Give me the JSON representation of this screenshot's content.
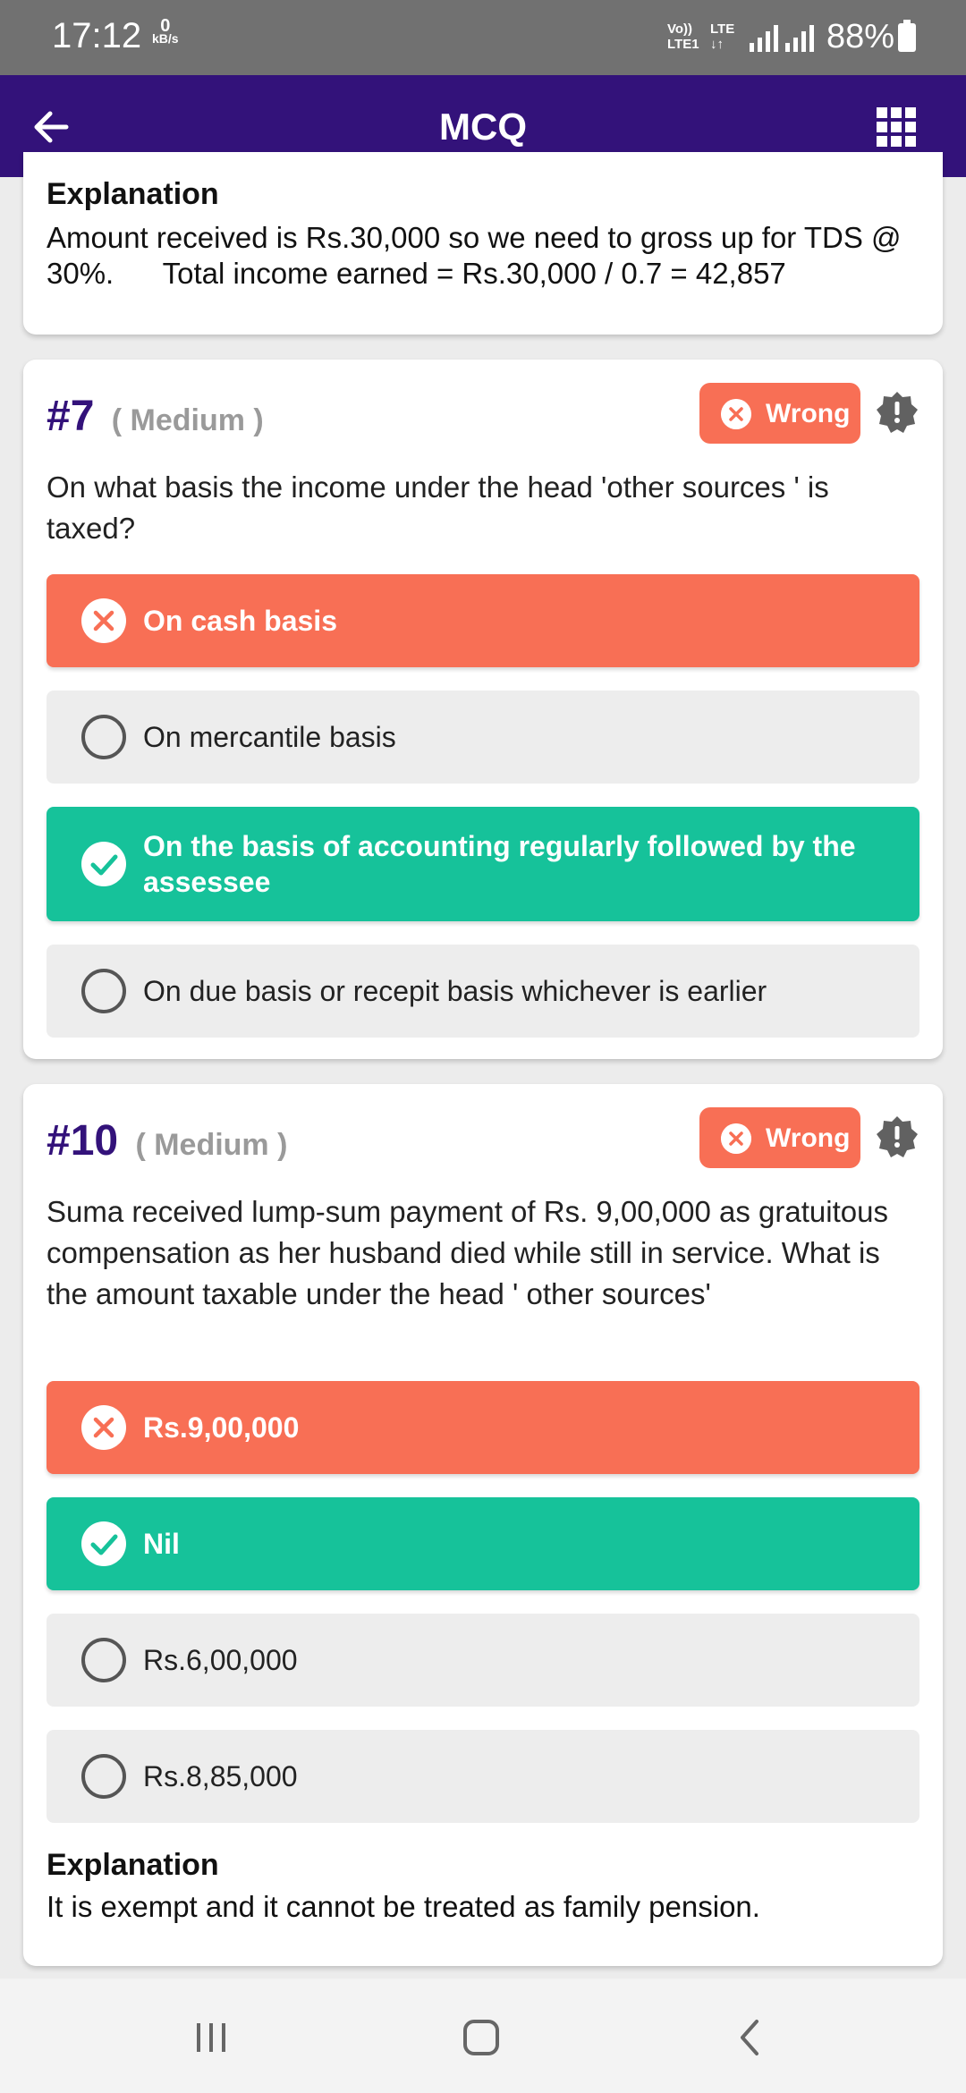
{
  "status_bar": {
    "time": "17:12",
    "net_speed_value": "0",
    "net_speed_unit": "kB/s",
    "volte_line1": "Vo))",
    "volte_line2": "LTE1",
    "lte_line1": "LTE",
    "lte_line2": "↓↑",
    "battery": "88%"
  },
  "app_bar": {
    "title": "MCQ",
    "back_icon": "arrow-left-icon",
    "menu_icon": "grid-icon"
  },
  "colors": {
    "primary": "#33127a",
    "wrong": "#f86f55",
    "correct": "#16c29a",
    "option_bg": "#ededed"
  },
  "cards": [
    {
      "explanation_title": "Explanation",
      "explanation_text": "Amount received is Rs.30,000 so we need to gross up for TDS @ 30%.      Total income earned = Rs.30,000 / 0.7 = 42,857"
    },
    {
      "number": "#7",
      "difficulty": "( Medium )",
      "status": "Wrong",
      "question": "On what basis the income under the head 'other sources ' is taxed?",
      "options": [
        {
          "label": "On cash basis",
          "state": "wrong"
        },
        {
          "label": "On mercantile basis",
          "state": "none"
        },
        {
          "label": "On the basis of accounting regularly followed by the assessee",
          "state": "correct"
        },
        {
          "label": "On due basis or recepit basis whichever is earlier",
          "state": "none"
        }
      ]
    },
    {
      "number": "#10",
      "difficulty": "( Medium )",
      "status": "Wrong",
      "question": "Suma received lump-sum payment of Rs. 9,00,000 as gratuitous compensation as her husband  died while still in service.  What is the amount taxable under the head ' other sources'",
      "options": [
        {
          "label": "Rs.9,00,000",
          "state": "wrong"
        },
        {
          "label": "Nil",
          "state": "correct"
        },
        {
          "label": "Rs.6,00,000",
          "state": "none"
        },
        {
          "label": "Rs.8,85,000",
          "state": "none"
        }
      ],
      "explanation_title": "Explanation",
      "explanation_text": "It is exempt and it cannot be treated as family pension."
    }
  ],
  "nav_bar": {
    "recent_icon": "recent-apps-icon",
    "home_icon": "home-icon",
    "back_icon": "back-chevron-icon"
  }
}
